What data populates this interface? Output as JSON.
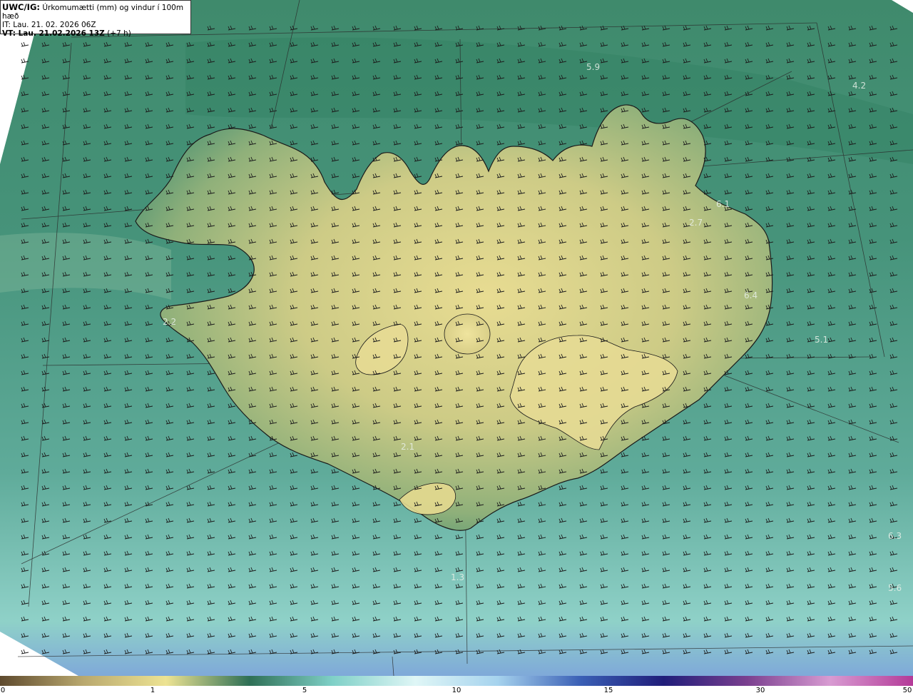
{
  "header": {
    "model": "UWC/IG:",
    "title": "Úrkomumætti (mm) og vindur í 100m hæð",
    "init_time": "IT: Lau. 21. 02. 2026 06Z",
    "valid_label": "VT: Lau. 21.02.2026 13Z",
    "lead": "(+7 h)"
  },
  "map_labels": [
    {
      "id": "v1",
      "text": "5.9"
    },
    {
      "id": "v2",
      "text": "4.2"
    },
    {
      "id": "v3",
      "text": "6.1"
    },
    {
      "id": "v4",
      "text": "2.7"
    },
    {
      "id": "v5",
      "text": "6.4"
    },
    {
      "id": "v6",
      "text": "5.1"
    },
    {
      "id": "v7",
      "text": "2.1"
    },
    {
      "id": "v8",
      "text": "6.3"
    },
    {
      "id": "v9",
      "text": "5.6"
    },
    {
      "id": "v10",
      "text": "2.2"
    },
    {
      "id": "v11",
      "text": "1.3"
    }
  ],
  "colorbar": {
    "ticks": [
      "0",
      "1",
      "5",
      "10",
      "15",
      "30",
      "50"
    ],
    "colors": [
      "#5e4a2e",
      "#b9a86e",
      "#ede393",
      "#2e6f55",
      "#7fd0c7",
      "#dff6f6",
      "#a6d3ee",
      "#3a5fb5",
      "#201d7a",
      "#7a3f8f",
      "#d89bd2",
      "#b43a98"
    ]
  },
  "legend_style": {
    "ocean": "#3f8f72",
    "land": "#d6cf8a",
    "coast": "#1a1a1a"
  }
}
